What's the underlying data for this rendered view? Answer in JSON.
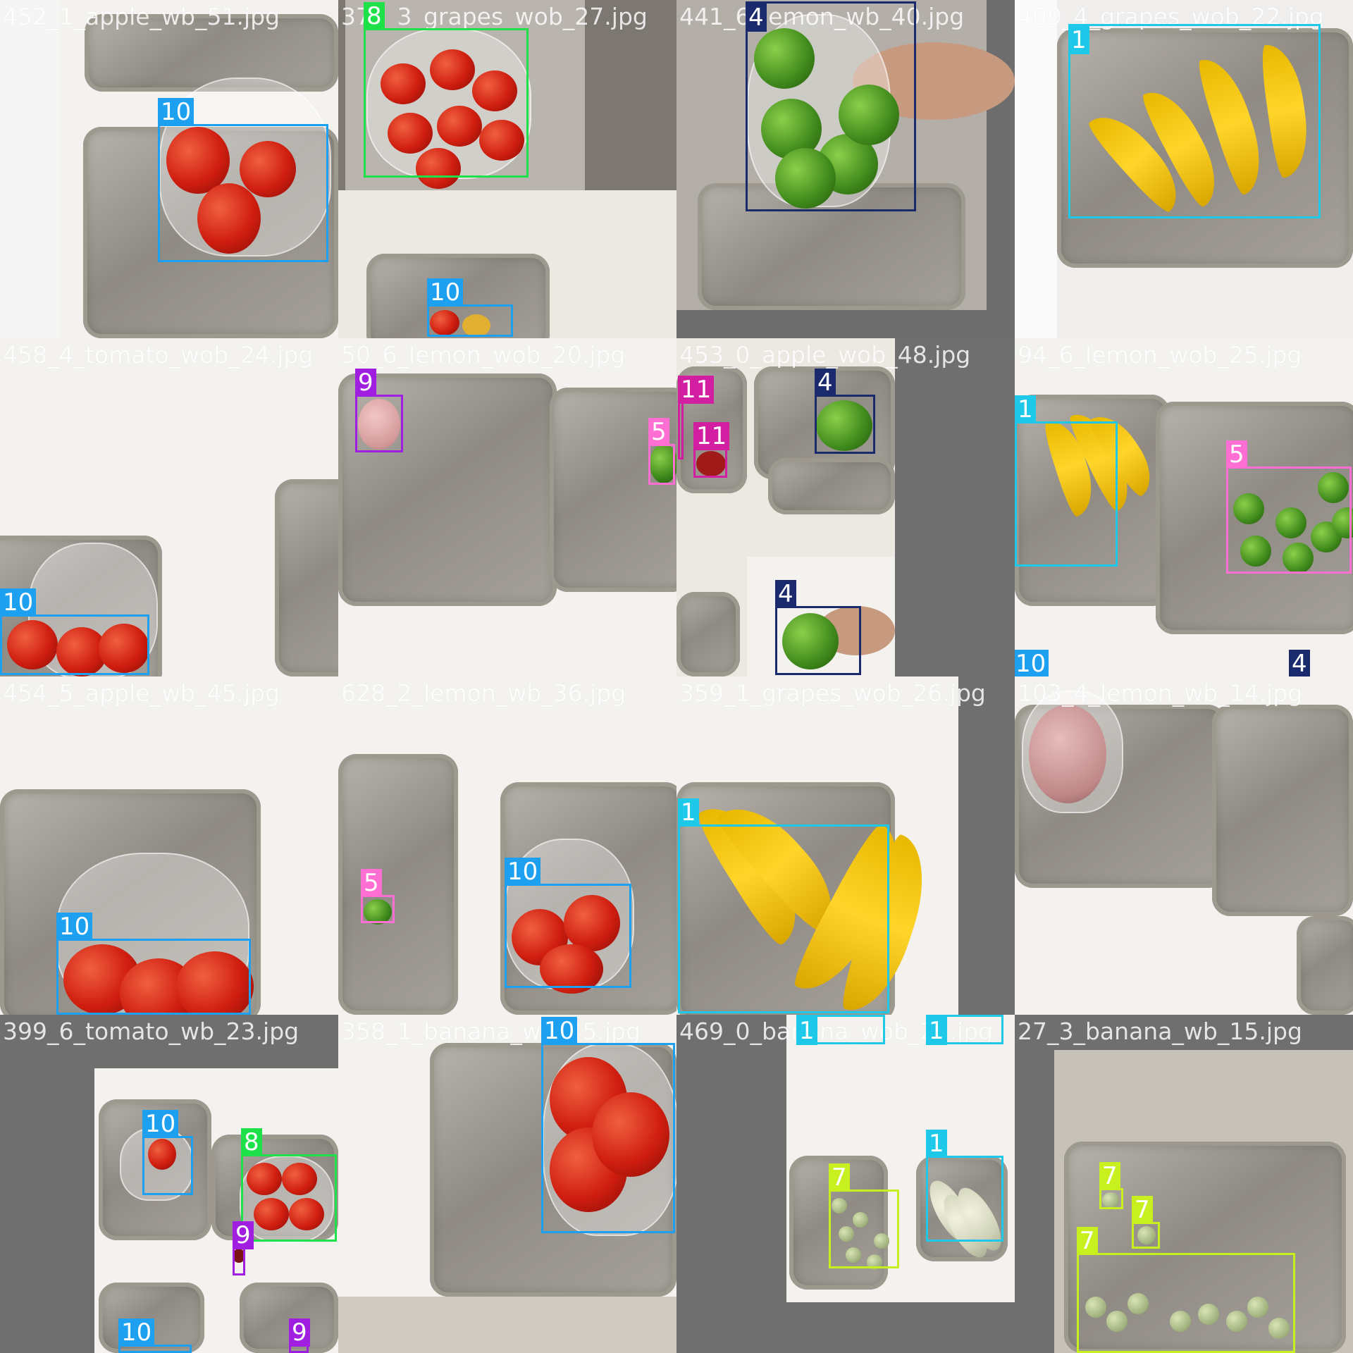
{
  "palette": {
    "1": "#1ec8e8",
    "4": "#1a2a6c",
    "5": "#ff6ed2",
    "7": "#c8f01e",
    "8": "#1ee14a",
    "9": "#a01ee0",
    "10": "#1ea0f0",
    "11": "#d21ea0"
  },
  "tiles": [
    {
      "filename": "452_1_apple_wb_51.jpg",
      "scene": "apple",
      "boxes": [
        {
          "cls": "10"
        }
      ]
    },
    {
      "filename": "378_3_grapes_wob_27.jpg",
      "scene": "tomato",
      "boxes": [
        {
          "cls": "8"
        },
        {
          "cls": "10"
        }
      ]
    },
    {
      "filename": "441_6_lemon_wb_40.jpg",
      "scene": "lime-hand",
      "boxes": [
        {
          "cls": "4"
        }
      ]
    },
    {
      "filename": "409_4_grapes_wob_22.jpg",
      "scene": "banana",
      "boxes": [
        {
          "cls": "1"
        }
      ]
    },
    {
      "filename": "458_4_tomato_wob_24.jpg",
      "scene": "apple-corner",
      "boxes": [
        {
          "cls": "10"
        }
      ]
    },
    {
      "filename": "50_6_lemon_wob_20.jpg",
      "scene": "trays",
      "boxes": [
        {
          "cls": "9"
        },
        {
          "cls": "5"
        }
      ]
    },
    {
      "filename": "453_0_apple_wob_48.jpg",
      "scene": "mixed",
      "boxes": [
        {
          "cls": "11"
        },
        {
          "cls": "11"
        },
        {
          "cls": "4"
        },
        {
          "cls": "4"
        }
      ]
    },
    {
      "filename": "94_6_lemon_wob_25.jpg",
      "scene": "banana-lime",
      "boxes": [
        {
          "cls": "1"
        },
        {
          "cls": "5"
        },
        {
          "cls": "10"
        },
        {
          "cls": "4"
        }
      ]
    },
    {
      "filename": "454_5_apple_wb_45.jpg",
      "scene": "apple-bottom",
      "boxes": [
        {
          "cls": "10"
        }
      ]
    },
    {
      "filename": "628_2_lemon_wb_36.jpg",
      "scene": "lime-apple",
      "boxes": [
        {
          "cls": "5"
        },
        {
          "cls": "10"
        }
      ]
    },
    {
      "filename": "359_1_grapes_wob_26.jpg",
      "scene": "banana-big",
      "boxes": [
        {
          "cls": "1"
        }
      ]
    },
    {
      "filename": "103_4_lemon_wb_14.jpg",
      "scene": "bag-left",
      "boxes": []
    },
    {
      "filename": "399_6_tomato_wb_23.jpg",
      "scene": "mosaic",
      "boxes": [
        {
          "cls": "10"
        },
        {
          "cls": "8"
        },
        {
          "cls": "9"
        },
        {
          "cls": "10"
        },
        {
          "cls": "9"
        }
      ]
    },
    {
      "filename": "358_1_banana_wb_45.jpg",
      "scene": "apple-right",
      "boxes": [
        {
          "cls": "10"
        }
      ]
    },
    {
      "filename": "469_0_banana_wob_25.jpg",
      "scene": "banana-mosaic",
      "boxes": [
        {
          "cls": "1"
        },
        {
          "cls": "1"
        },
        {
          "cls": "7"
        },
        {
          "cls": "1"
        }
      ]
    },
    {
      "filename": "27_3_banana_wb_15.jpg",
      "scene": "grapes",
      "boxes": [
        {
          "cls": "7"
        },
        {
          "cls": "7"
        },
        {
          "cls": "7"
        }
      ]
    }
  ]
}
